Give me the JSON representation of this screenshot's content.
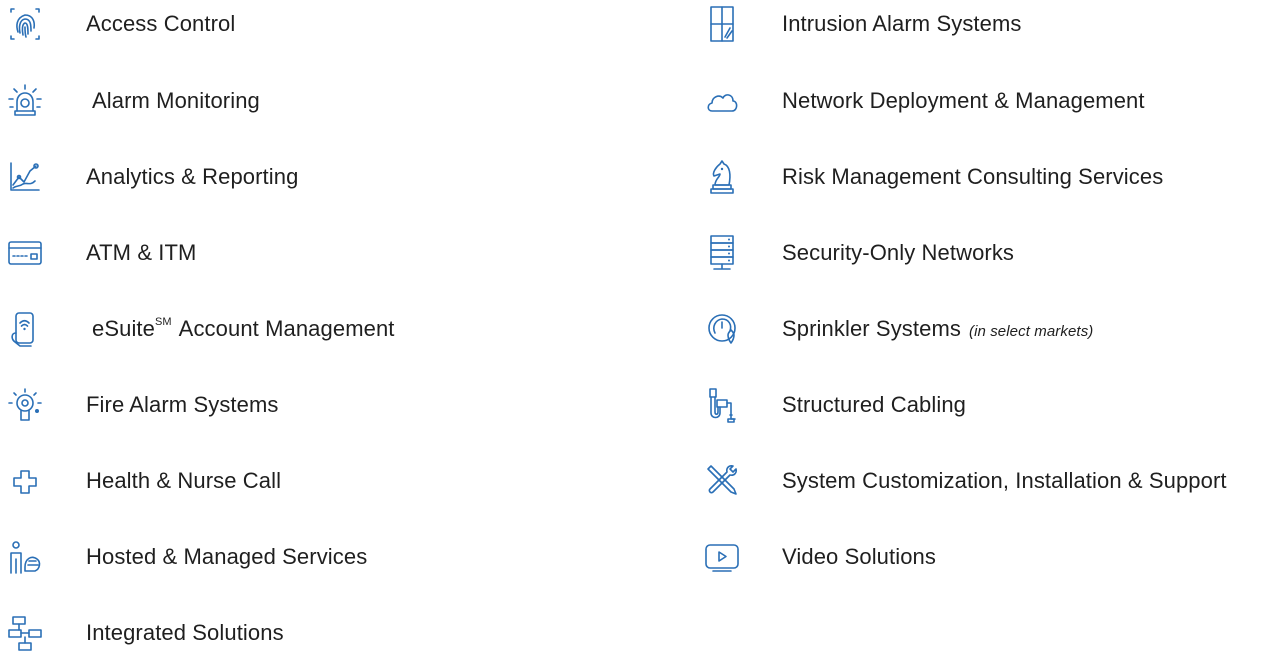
{
  "accent_color": "#2a6fb6",
  "text_color": "#1f1f1f",
  "left_items": [
    {
      "icon": "fingerprint-icon",
      "label": "Access Control"
    },
    {
      "icon": "alarm-beacon-icon",
      "label": "Alarm Monitoring"
    },
    {
      "icon": "analytics-chart-icon",
      "label": "Analytics & Reporting"
    },
    {
      "icon": "card-icon",
      "label": "ATM & ITM"
    },
    {
      "icon": "smartphone-hand-icon",
      "label_pre": "eSuite",
      "label_sup": "SM",
      "label_post": " Account Management"
    },
    {
      "icon": "smoke-detector-icon",
      "label": "Fire Alarm Systems"
    },
    {
      "icon": "medical-cross-icon",
      "label": "Health & Nurse Call"
    },
    {
      "icon": "person-server-icon",
      "label": "Hosted & Managed Services"
    },
    {
      "icon": "integrated-network-icon",
      "label": "Integrated Solutions"
    }
  ],
  "right_items": [
    {
      "icon": "window-sensor-icon",
      "label": "Intrusion Alarm Systems"
    },
    {
      "icon": "cloud-icon",
      "label": "Network Deployment & Management"
    },
    {
      "icon": "chess-knight-icon",
      "label": "Risk Management Consulting Services"
    },
    {
      "icon": "server-stack-icon",
      "label": "Security-Only Networks"
    },
    {
      "icon": "sprinkler-gauge-icon",
      "label": "Sprinkler Systems",
      "note": "(in select markets)"
    },
    {
      "icon": "cable-icon",
      "label": "Structured Cabling"
    },
    {
      "icon": "tools-icon",
      "label": "System Customization, Installation & Support"
    },
    {
      "icon": "video-play-icon",
      "label": "Video Solutions"
    }
  ]
}
